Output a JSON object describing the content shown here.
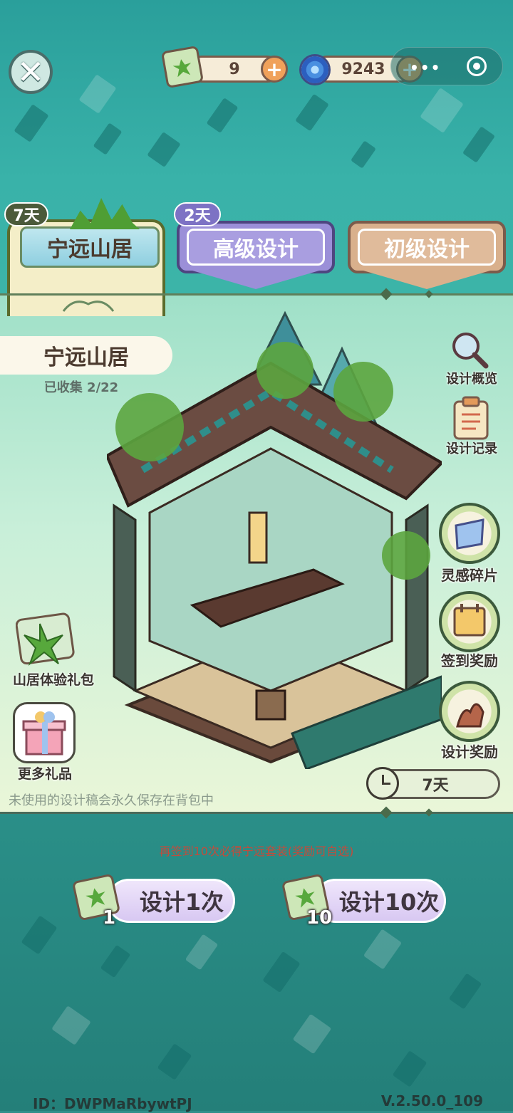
{
  "currency": {
    "scrolls": "9",
    "coins": "9243"
  },
  "tabs": [
    {
      "label": "宁远山居",
      "badge": "7天"
    },
    {
      "label": "高级设计",
      "badge": "2天"
    },
    {
      "label": "初级设计"
    }
  ],
  "house": {
    "name": "宁远山居",
    "collected": "已收集 2/22"
  },
  "right_links": [
    {
      "label": "设计概览"
    },
    {
      "label": "设计记录"
    }
  ],
  "round_buttons": [
    {
      "label": "灵感碎片"
    },
    {
      "label": "签到奖励"
    },
    {
      "label": "设计奖励"
    }
  ],
  "left_buttons": [
    {
      "label": "山居体验礼包"
    },
    {
      "label": "更多礼品"
    }
  ],
  "timer": "7天",
  "save_note": "未使用的设计稿会永久保存在背包中",
  "red_note": "再签到10次必得宁远套装(奖励可自选)",
  "draw": {
    "once_label": "设计1次",
    "once_count": "1",
    "ten_label": "设计10次",
    "ten_count": "10"
  },
  "footer": {
    "id": "ID：DWPMaRbywtPJ",
    "version": "V.2.50.0_109"
  },
  "colors": {
    "teal": "#2e8f8a",
    "tab_purple": "#9b8fd8",
    "tab_tan": "#d9b08c",
    "red_note": "#c44b3b"
  }
}
